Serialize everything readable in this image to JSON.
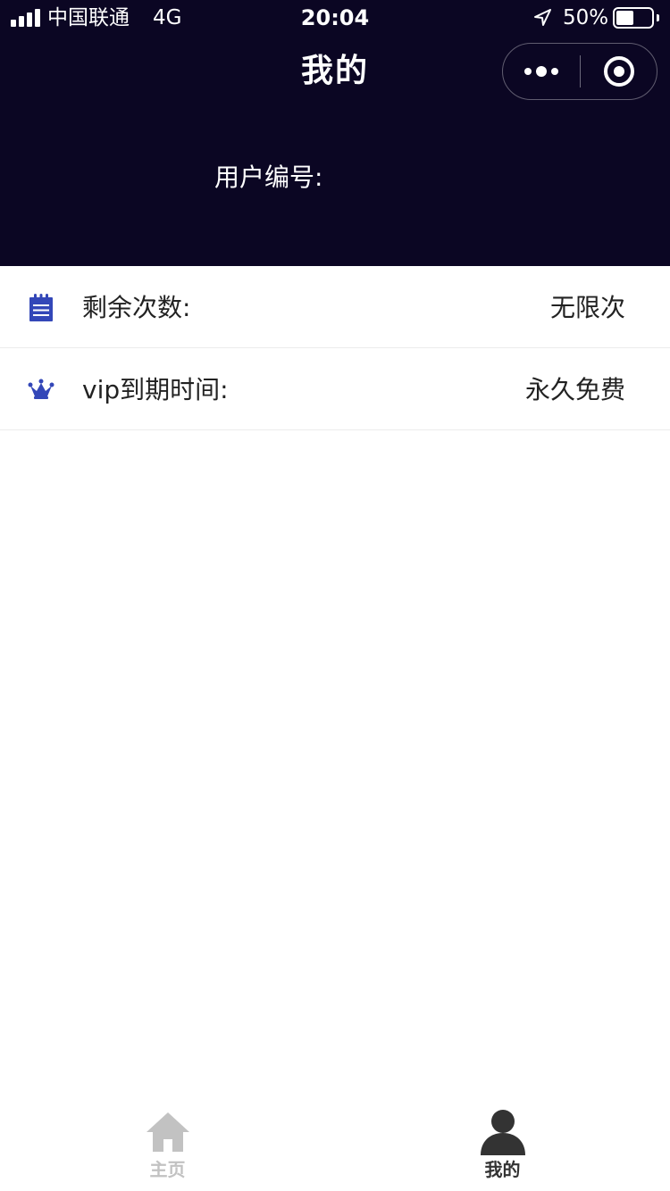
{
  "status_bar": {
    "carrier": "中国联通",
    "network": "4G",
    "time": "20:04",
    "battery_percent": "50%",
    "battery_level": 0.5
  },
  "nav": {
    "title": "我的"
  },
  "profile": {
    "user_id_label": "用户编号:"
  },
  "list": {
    "items": [
      {
        "label": "剩余次数:",
        "value": "无限次",
        "icon": "notepad-icon"
      },
      {
        "label": "vip到期时间:",
        "value": "永久免费",
        "icon": "crown-icon"
      }
    ]
  },
  "tabbar": {
    "tabs": [
      {
        "label": "主页",
        "icon": "home-icon",
        "active": false
      },
      {
        "label": "我的",
        "icon": "person-icon",
        "active": true
      }
    ]
  },
  "colors": {
    "header_bg": "#0b0623",
    "accent_icon": "#3347b8",
    "tab_active": "#333333",
    "tab_inactive": "#c2c2c2"
  }
}
